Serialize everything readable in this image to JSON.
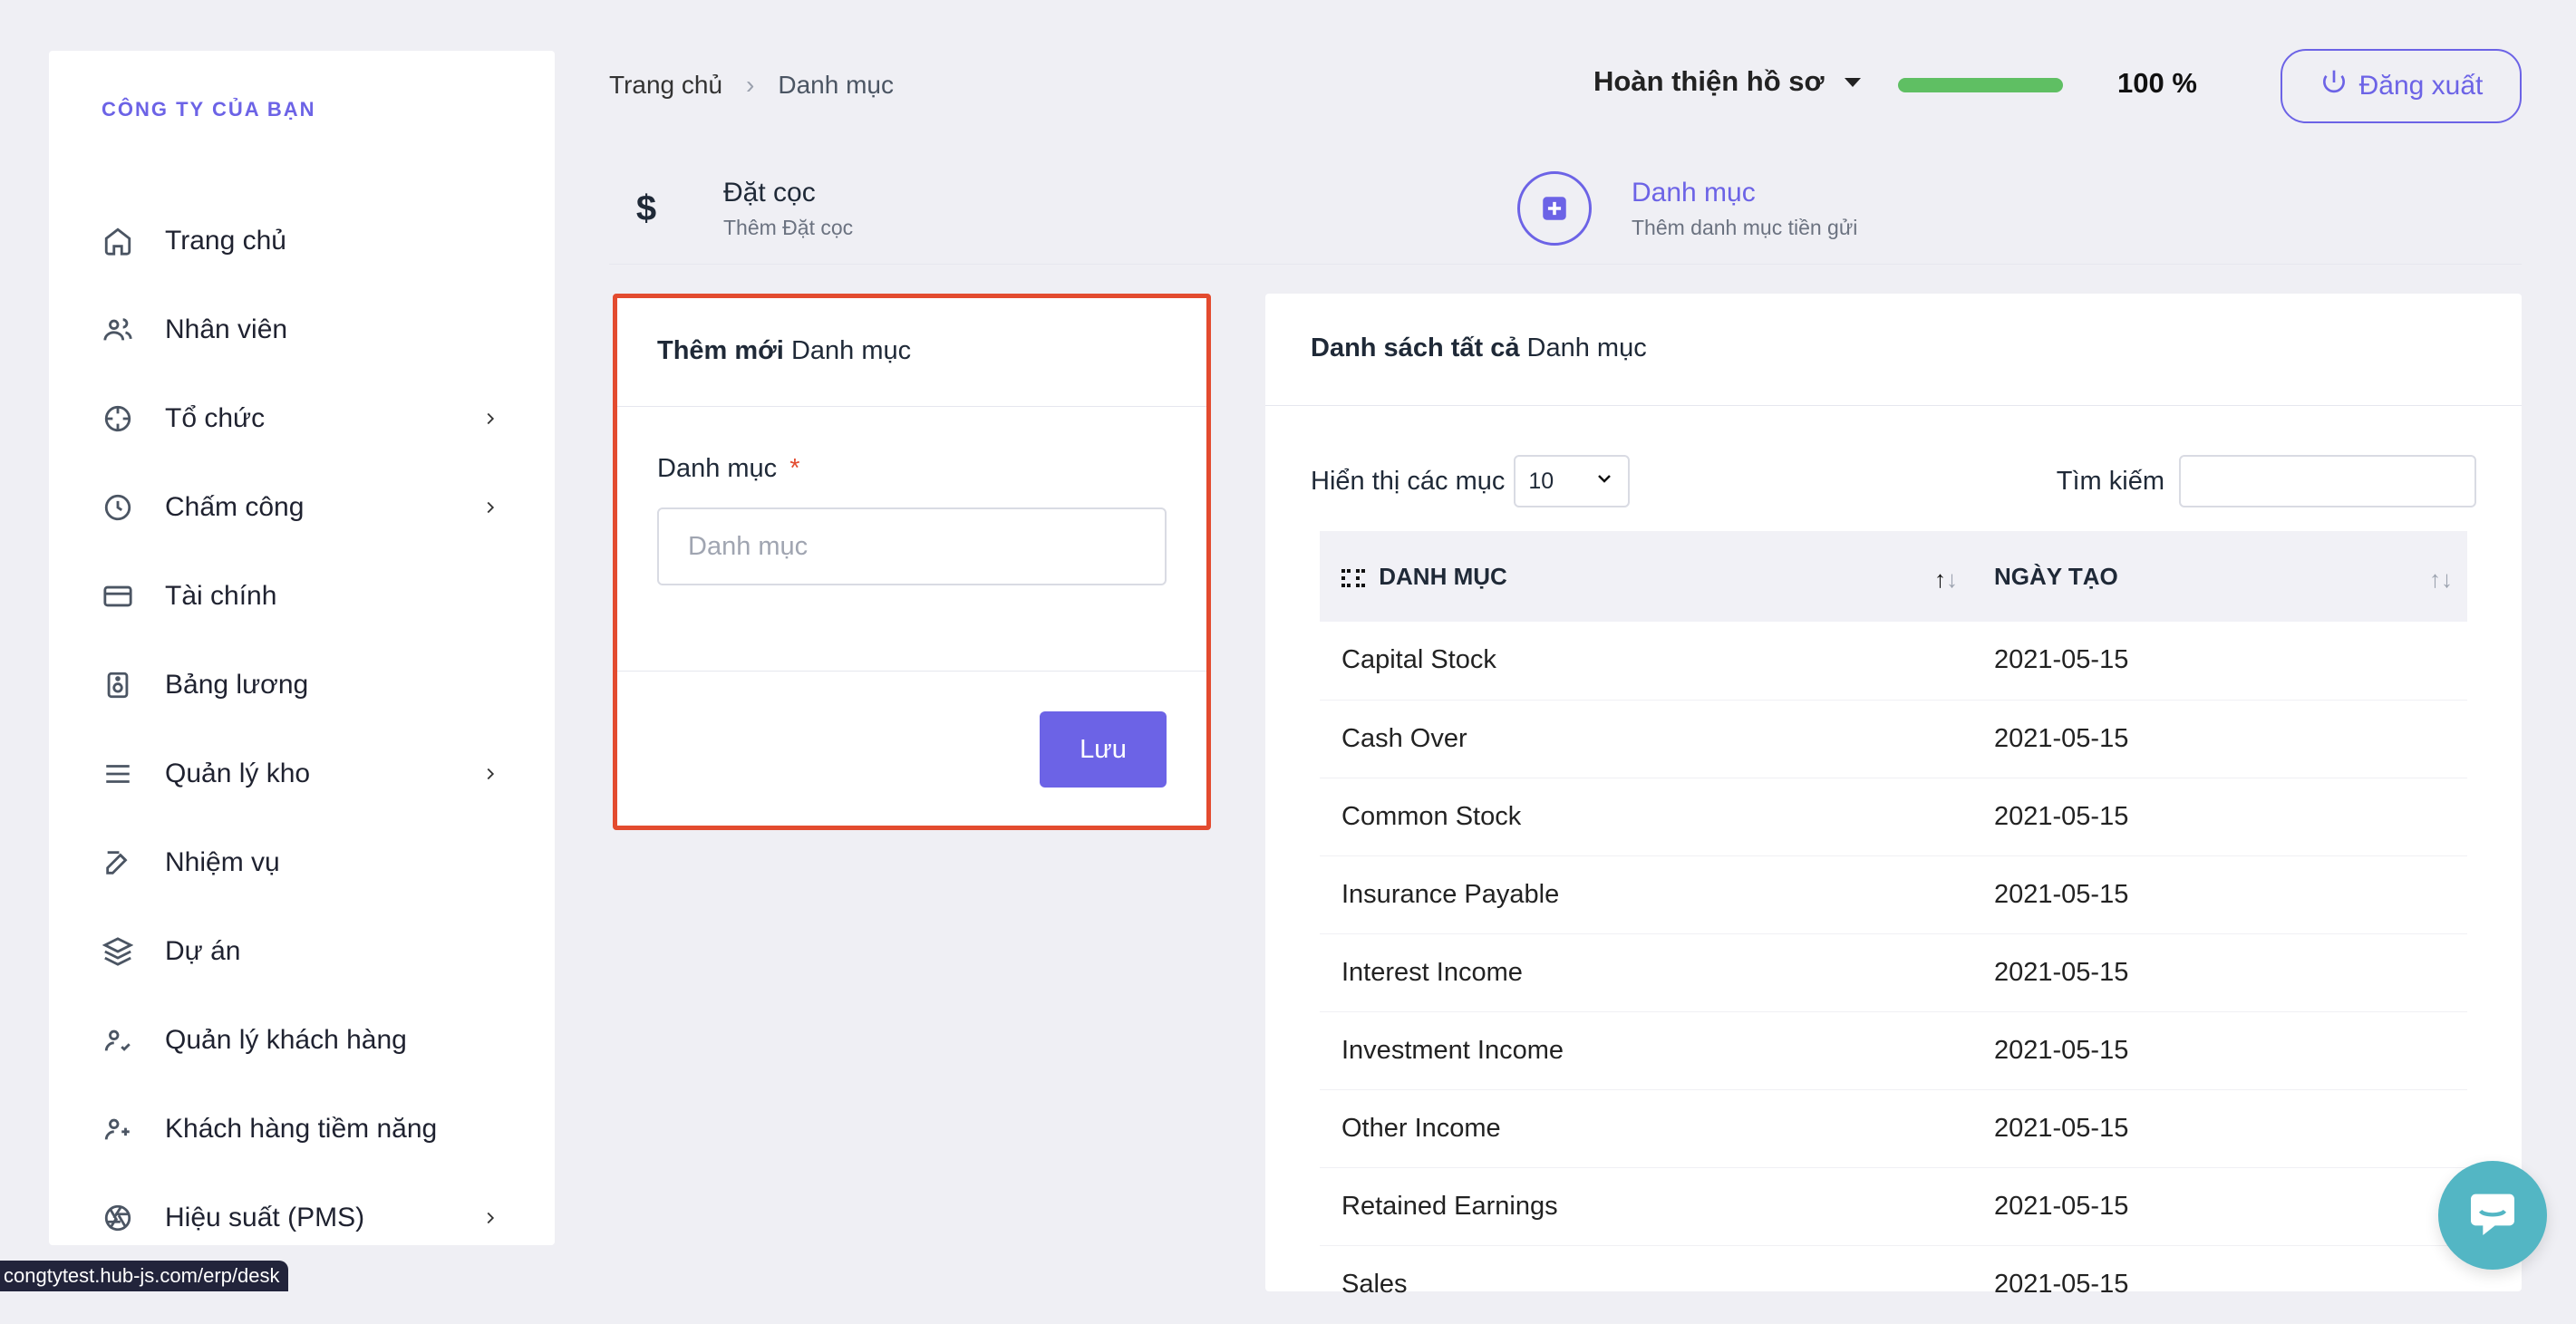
{
  "sidebar": {
    "brand": "CÔNG TY CỦA BẠN",
    "items": [
      {
        "label": "Trang chủ",
        "icon": "home-icon",
        "has_children": false
      },
      {
        "label": "Nhân viên",
        "icon": "users-icon",
        "has_children": false
      },
      {
        "label": "Tổ chức",
        "icon": "crosshair-icon",
        "has_children": true
      },
      {
        "label": "Chấm công",
        "icon": "clock-icon",
        "has_children": true
      },
      {
        "label": "Tài chính",
        "icon": "credit-card-icon",
        "has_children": false
      },
      {
        "label": "Bảng lương",
        "icon": "speaker-icon",
        "has_children": false
      },
      {
        "label": "Quản lý kho",
        "icon": "menu-icon",
        "has_children": true
      },
      {
        "label": "Nhiệm vụ",
        "icon": "edit-icon",
        "has_children": false
      },
      {
        "label": "Dự án",
        "icon": "layers-icon",
        "has_children": false
      },
      {
        "label": "Quản lý khách hàng",
        "icon": "user-check-icon",
        "has_children": false
      },
      {
        "label": "Khách hàng tiềm năng",
        "icon": "user-plus-icon",
        "has_children": false
      },
      {
        "label": "Hiệu suất (PMS)",
        "icon": "aperture-icon",
        "has_children": true
      }
    ]
  },
  "breadcrumb": {
    "home": "Trang chủ",
    "current": "Danh mục"
  },
  "header": {
    "profile_label": "Hoàn thiện hồ sơ",
    "progress_percent": 100,
    "progress_text": "100 %",
    "logout_label": "Đăng xuất"
  },
  "shortcuts": {
    "deposit": {
      "title": "Đặt cọc",
      "subtitle": "Thêm Đặt cọc",
      "icon": "dollar-icon"
    },
    "category": {
      "title": "Danh mục",
      "subtitle": "Thêm danh mục tiền gửi",
      "icon": "plus-square-icon"
    }
  },
  "add_form": {
    "title_strong": "Thêm mới",
    "title_rest": "Danh mục",
    "field_label": "Danh mục",
    "required_mark": "*",
    "placeholder": "Danh mục",
    "save_label": "Lưu"
  },
  "list": {
    "title_strong": "Danh sách tất cả",
    "title_rest": "Danh mục",
    "show_label": "Hiển thị các mục",
    "page_size": "10",
    "search_label": "Tìm kiếm",
    "columns": [
      "DANH MỤC",
      "NGÀY TẠO"
    ],
    "rows": [
      {
        "name": "Capital Stock",
        "date": "2021-05-15"
      },
      {
        "name": "Cash Over",
        "date": "2021-05-15"
      },
      {
        "name": "Common Stock",
        "date": "2021-05-15"
      },
      {
        "name": "Insurance Payable",
        "date": "2021-05-15"
      },
      {
        "name": "Interest Income",
        "date": "2021-05-15"
      },
      {
        "name": "Investment Income",
        "date": "2021-05-15"
      },
      {
        "name": "Other Income",
        "date": "2021-05-15"
      },
      {
        "name": "Retained Earnings",
        "date": "2021-05-15"
      },
      {
        "name": "Sales",
        "date": "2021-05-15"
      }
    ]
  },
  "statusbar": {
    "url": "congtytest.hub-js.com/erp/desk"
  },
  "colors": {
    "primary": "#6c63e6",
    "success": "#5fbf63",
    "highlight": "#e34b2f",
    "chat": "#53b6c4"
  }
}
